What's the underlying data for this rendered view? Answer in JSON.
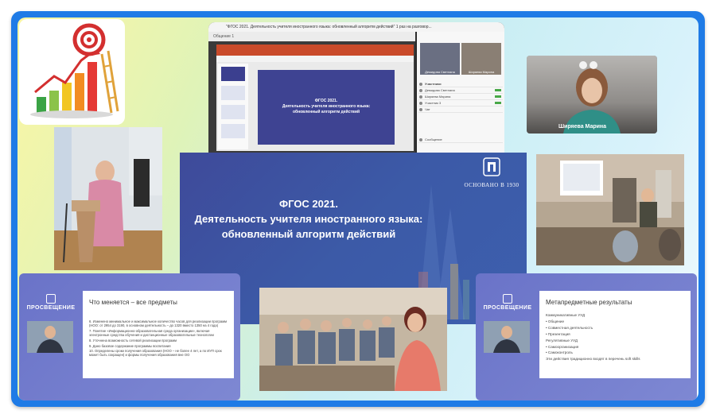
{
  "call_window": {
    "title": "\"ФГОС 2021. Деятельность учителя иностранного языка: обновленный алгоритм действий\" 1 раз на разговор...",
    "tab": "Общение 1",
    "slide_lines": [
      "ФГОС 2021.",
      "Деятельность учителя иностранного языка:",
      "обновленный алгоритм действий"
    ],
    "participants": [
      {
        "name": "Демидова Светлана"
      },
      {
        "name": "Ширяева Марина"
      }
    ],
    "list_header": "Участники",
    "list_rows": [
      "Демидова Светлана",
      "Ширяева Марина",
      "Участник 3",
      "Чат"
    ],
    "chat_hint": "Сообщение"
  },
  "webcam": {
    "name": "Ширяева Марина"
  },
  "main_slide": {
    "line1": "ФГОС 2021.",
    "line2": "Деятельность учителя иностранного языка:",
    "line3": "обновленный алгоритм действий",
    "established": "ОСНОВАНО В 1930"
  },
  "left_slide": {
    "brand": "ПРОСВЕЩЕНИЕ",
    "heading": "Что меняется – все предметы",
    "items": [
      "6. Изменено минимальное и максимальное количество часов для реализации программ (НОО: от 2954 до 3190, в основном деятельность – до 1320 вместо 1350 на 4 года)",
      "7. Понятие «Информационно-образовательная среда организации», включая электронные средства обучения и дистанционные образовательные технологии",
      "8. Уточнена возможность сетевой реализации программ",
      "9. Дано базовое содержание программы воспитания",
      "10. Определены сроки получения образования (НОО – не более 4 лет, а по ИУП срок может быть сокращен) и формы получения образования вне ОО"
    ]
  },
  "right_slide": {
    "brand": "ПРОСВЕЩЕНИЕ",
    "heading": "Метапредметные результаты",
    "items": [
      "Коммуникативные УУД",
      "• Общение",
      "• Совместная деятельность",
      "• Презентация",
      "Регулятивные УУД",
      "• Самоорганизация",
      "• Самоконтроль",
      "Эти действия традиционно входят в перечень soft skills"
    ]
  },
  "colors": {
    "frame": "#1f7be6",
    "slide_blue": "#3d4f9f",
    "slide_violet": "#7a83d0"
  }
}
